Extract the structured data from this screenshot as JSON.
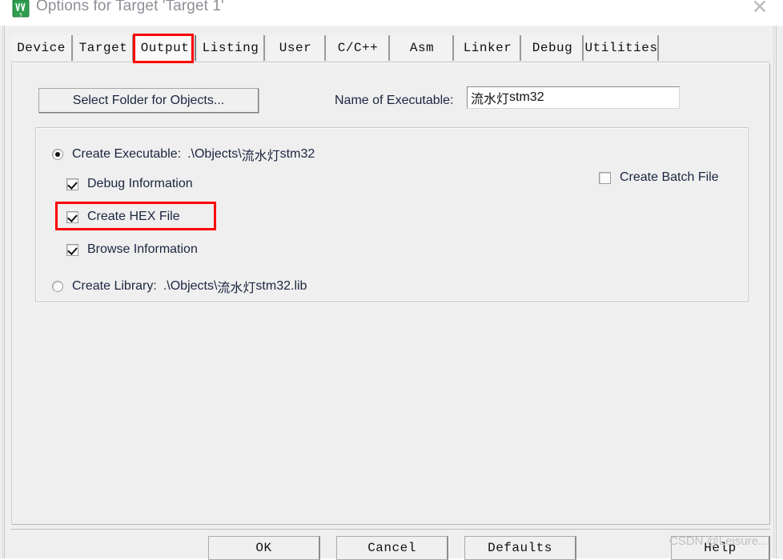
{
  "window": {
    "title": "Options for Target 'Target 1'",
    "app_icon": "keil-uvision5-icon",
    "close_label": "✕"
  },
  "tabs": [
    {
      "label": "Device",
      "selected": false
    },
    {
      "label": "Target",
      "selected": false
    },
    {
      "label": "Output",
      "selected": true
    },
    {
      "label": "Listing",
      "selected": false
    },
    {
      "label": "User",
      "selected": false
    },
    {
      "label": "C/C++",
      "selected": false
    },
    {
      "label": "Asm",
      "selected": false
    },
    {
      "label": "Linker",
      "selected": false
    },
    {
      "label": "Debug",
      "selected": false
    },
    {
      "label": "Utilities",
      "selected": false
    }
  ],
  "output": {
    "select_folder_button": "Select Folder for Objects...",
    "exe_name_label": "Name of Executable:",
    "exe_name_value_cjk": "流水灯",
    "exe_name_value_ascii": "stm32",
    "create_executable_label": "Create Executable:",
    "create_executable_path_prefix": ".\\Objects\\",
    "create_executable_path_cjk": "流水灯",
    "create_executable_path_suffix": "stm32",
    "create_executable_checked": true,
    "debug_information_label": "Debug Information",
    "debug_information_checked": true,
    "create_hex_file_label": "Create HEX File",
    "create_hex_file_checked": true,
    "browse_information_label": "Browse Information",
    "browse_information_checked": true,
    "create_batch_file_label": "Create Batch File",
    "create_batch_file_checked": false,
    "create_library_label": "Create Library:",
    "create_library_path_prefix": ".\\Objects\\",
    "create_library_path_cjk": "流水灯",
    "create_library_path_suffix": "stm32.lib",
    "create_library_checked": false
  },
  "footer": {
    "ok": "OK",
    "cancel": "Cancel",
    "defaults": "Defaults",
    "help": "Help"
  },
  "watermark": "CSDN @Leisure...",
  "colors": {
    "annotation_red": "#fe0000",
    "dialog_bg": "#efefef",
    "title_text": "#8d9096",
    "label_text": "#1b2540"
  }
}
